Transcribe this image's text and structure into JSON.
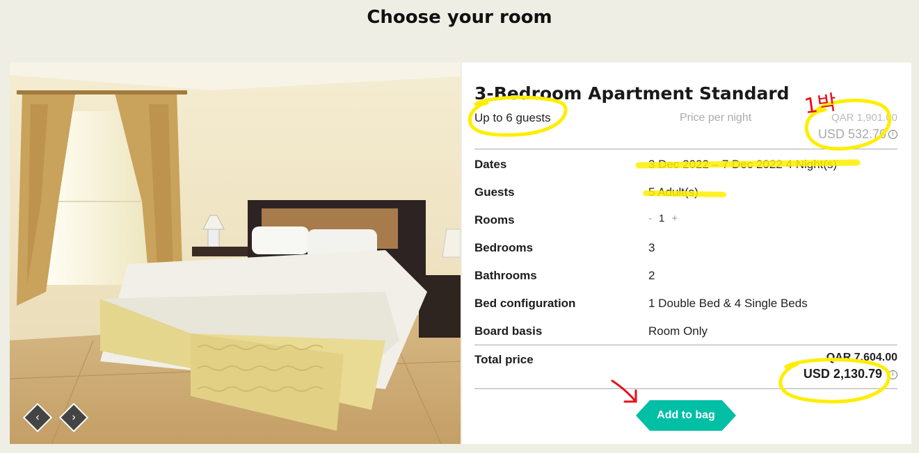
{
  "page_title": "Choose your room",
  "room": {
    "name": "3-Bedroom Apartment Standard",
    "capacity": "Up to 6 guests",
    "price_per_night_label": "Price per night",
    "price_per_night_qar": "QAR 1,901.00",
    "price_per_night_usd": "USD 532.70"
  },
  "details": {
    "dates_label": "Dates",
    "dates_value": "3 Dec 2022 – 7 Dec 2022  4 Night(s)",
    "guests_label": "Guests",
    "guests_value": "5 Adult(s)",
    "rooms_label": "Rooms",
    "rooms_value": "1",
    "bedrooms_label": "Bedrooms",
    "bedrooms_value": "3",
    "bathrooms_label": "Bathrooms",
    "bathrooms_value": "2",
    "bed_config_label": "Bed configuration",
    "bed_config_value": "1 Double Bed & 4 Single Beds",
    "board_label": "Board basis",
    "board_value": "Room Only"
  },
  "total": {
    "label": "Total price",
    "qar": "QAR 7,604.00",
    "usd": "USD 2,130.79"
  },
  "buttons": {
    "add_to_bag": "Add to bag",
    "stepper_minus": "-",
    "stepper_plus": "+",
    "prev": "‹",
    "next": "›",
    "info": "i"
  },
  "annotations": {
    "handwritten_note": "1박",
    "highlight_color": "#ffee00",
    "pen_color": "#e8101a"
  },
  "colors": {
    "background": "#efeee4",
    "accent": "#00bfa5"
  }
}
